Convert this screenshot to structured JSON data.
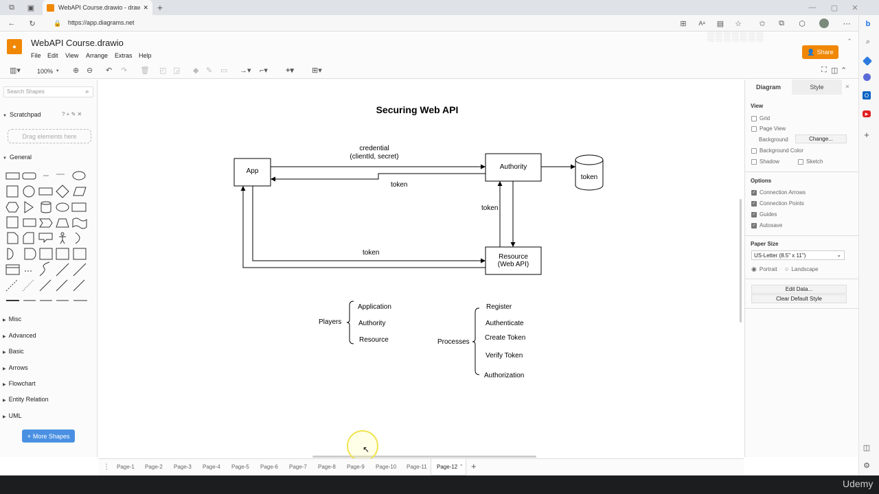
{
  "browser": {
    "tab_title": "WebAPI Course.drawio - draw.io",
    "url": "https://app.diagrams.net"
  },
  "app": {
    "title": "WebAPI Course.drawio",
    "menu": [
      "File",
      "Edit",
      "View",
      "Arrange",
      "Extras",
      "Help"
    ],
    "share_label": "Share",
    "zoom": "100%"
  },
  "left_panel": {
    "search_placeholder": "Search Shapes",
    "scratchpad": "Scratchpad",
    "drop_hint": "Drag elements here",
    "general": "General",
    "sections": [
      "Misc",
      "Advanced",
      "Basic",
      "Arrows",
      "Flowchart",
      "Entity Relation",
      "UML"
    ],
    "more_shapes": "More Shapes"
  },
  "diagram": {
    "title": "Securing Web API",
    "app_box": "App",
    "authority_box": "Authority",
    "token_cylinder": "token",
    "resource_box_line1": "Resource",
    "resource_box_line2": "(Web API)",
    "credential_line1": "credential",
    "credential_line2": "(clientId, secret)",
    "token_label_1": "token",
    "token_label_2": "token",
    "token_label_3": "token",
    "players_label": "Players",
    "players": [
      "Application",
      "Authority",
      "Resource"
    ],
    "processes_label": "Processes",
    "processes": [
      "Register",
      "Authenticate",
      "Create Token",
      "Verify Token",
      "Authorization"
    ]
  },
  "right_panel": {
    "tab_diagram": "Diagram",
    "tab_style": "Style",
    "view": "View",
    "grid": "Grid",
    "page_view": "Page View",
    "background": "Background",
    "change": "Change...",
    "background_color": "Background Color",
    "shadow": "Shadow",
    "sketch": "Sketch",
    "options": "Options",
    "connection_arrows": "Connection Arrows",
    "connection_points": "Connection Points",
    "guides": "Guides",
    "autosave": "Autosave",
    "paper_size": "Paper Size",
    "paper_value": "US-Letter (8.5\" x 11\")",
    "portrait": "Portrait",
    "landscape": "Landscape",
    "edit_data": "Edit Data...",
    "clear_style": "Clear Default Style"
  },
  "pages": [
    "Page-1",
    "Page-2",
    "Page-3",
    "Page-4",
    "Page-5",
    "Page-6",
    "Page-7",
    "Page-8",
    "Page-9",
    "Page-10",
    "Page-11",
    "Page-12"
  ],
  "active_page": "Page-12",
  "watermark": "Udemy",
  "colors": {
    "accent": "#f08705",
    "link_blue": "#4a90e2"
  }
}
